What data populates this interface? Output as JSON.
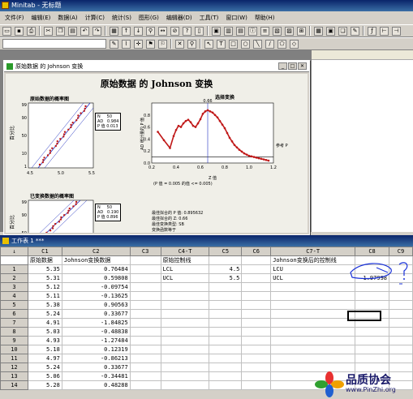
{
  "app": {
    "title": "Minitab - 无标题"
  },
  "menu": [
    "文件(F)",
    "编辑(E)",
    "数据(A)",
    "计算(C)",
    "统计(S)",
    "图形(G)",
    "编辑器(D)",
    "工具(T)",
    "窗口(W)",
    "帮助(H)"
  ],
  "graph_window": {
    "title": "原始数据 的 Johnson 变换",
    "graph_title": "原始数据 的 Johnson 变换",
    "pp_orig_title": "原始数据的概率图",
    "pp_orig_ylabel": "百分比",
    "pp_orig_legend": "N     50\nAD   0.984\nP 值 0.013",
    "pp_trans_title": "已变换数据的概率图",
    "pp_trans_ylabel": "百分比",
    "pp_trans_legend": "N     50\nAD   0.190\nP 值 0.896",
    "sel_title": "选择变换",
    "sel_ylabel": "AD 统计量的 P 值",
    "sel_xlabel": "Z 值",
    "sel_ref_label": "参考 P",
    "sel_peak_label": "0.66",
    "sel_note": "(P 值 = 0.005 的值 <= 0.005)",
    "info_lines": [
      "最佳拟合的 P 值: 0.895632",
      "最佳拟合的 Z: 0.66",
      "最佳变换类型: SB",
      "变换函数等于"
    ]
  },
  "chart_data": [
    {
      "type": "scatter",
      "title": "原始数据的概率图",
      "ylabel": "百分比",
      "xlim": [
        4.5,
        5.5
      ],
      "x_ticks": [
        "4.5",
        "5.0",
        "5.5"
      ],
      "y_ticks": [
        "99",
        "90",
        "50",
        "10",
        "1"
      ],
      "legend": {
        "N": 50,
        "AD": 0.984,
        "P 值": 0.013
      }
    },
    {
      "type": "line",
      "title": "选择变换",
      "xlabel": "Z 值",
      "ylabel": "AD 统计量的 P 值",
      "xlim": [
        0.2,
        1.2
      ],
      "ylim": [
        0,
        1.0
      ],
      "x_ticks": [
        "0.2",
        "0.4",
        "0.6",
        "0.8",
        "1.0",
        "1.2"
      ],
      "y_ticks": [
        "0.0",
        "0.2",
        "0.4",
        "0.6",
        "0.8"
      ],
      "reference_p": 0.1,
      "best_z": 0.66,
      "x": [
        0.25,
        0.3,
        0.35,
        0.38,
        0.4,
        0.42,
        0.44,
        0.46,
        0.48,
        0.5,
        0.52,
        0.54,
        0.56,
        0.58,
        0.6,
        0.62,
        0.64,
        0.66,
        0.68,
        0.7,
        0.72,
        0.74,
        0.76,
        0.78,
        0.8,
        0.82,
        0.84,
        0.86,
        0.88,
        0.9,
        0.92,
        0.94,
        0.96,
        0.98,
        1.0,
        1.02,
        1.04,
        1.06,
        1.08,
        1.1,
        1.12,
        1.14,
        1.16
      ],
      "y": [
        0.52,
        0.38,
        0.25,
        0.45,
        0.55,
        0.62,
        0.6,
        0.66,
        0.7,
        0.72,
        0.68,
        0.62,
        0.6,
        0.66,
        0.73,
        0.82,
        0.86,
        0.88,
        0.86,
        0.84,
        0.8,
        0.76,
        0.7,
        0.64,
        0.58,
        0.5,
        0.42,
        0.36,
        0.3,
        0.26,
        0.22,
        0.19,
        0.16,
        0.14,
        0.12,
        0.11,
        0.1,
        0.09,
        0.08,
        0.07,
        0.06,
        0.05,
        0.04
      ]
    },
    {
      "type": "scatter",
      "title": "已变换数据的概率图",
      "ylabel": "百分比",
      "y_ticks": [
        "99",
        "90",
        "50"
      ],
      "legend": {
        "N": 50,
        "AD": 0.19,
        "P 值": 0.896
      }
    }
  ],
  "worksheet": {
    "title": "工作表 1 ***",
    "col_headers": [
      "↓",
      "C1",
      "C2",
      "C3",
      "C4-T",
      "C5",
      "C6",
      "C7-T",
      "C8",
      "C9"
    ],
    "col_names": [
      "",
      "原始数据",
      "Johnson变换数据",
      "",
      "原始控制线",
      "",
      "",
      "Johnson变换后的控制线",
      "",
      ""
    ],
    "rows": [
      [
        "1",
        "5.35",
        "0.76484",
        "",
        "LCL",
        "4.5",
        "",
        "LCU",
        "",
        ""
      ],
      [
        "2",
        "5.31",
        "0.59808",
        "",
        "UCL",
        "5.5",
        "",
        "UCL",
        "1.97998",
        ""
      ],
      [
        "3",
        "5.12",
        "-0.09754",
        "",
        "",
        "",
        "",
        "",
        "",
        ""
      ],
      [
        "4",
        "5.11",
        "-0.13625",
        "",
        "",
        "",
        "",
        "",
        "",
        ""
      ],
      [
        "5",
        "5.38",
        "0.90563",
        "",
        "",
        "",
        "",
        "",
        "",
        ""
      ],
      [
        "6",
        "5.24",
        "0.33677",
        "",
        "",
        "",
        "",
        "",
        "",
        ""
      ],
      [
        "7",
        "4.91",
        "-1.84825",
        "",
        "",
        "",
        "",
        "",
        "",
        ""
      ],
      [
        "8",
        "5.03",
        "-0.48838",
        "",
        "",
        "",
        "",
        "",
        "",
        ""
      ],
      [
        "9",
        "4.93",
        "-1.27484",
        "",
        "",
        "",
        "",
        "",
        "",
        ""
      ],
      [
        "10",
        "5.18",
        "0.12319",
        "",
        "",
        "",
        "",
        "",
        "",
        ""
      ],
      [
        "11",
        "4.97",
        "-0.86213",
        "",
        "",
        "",
        "",
        "",
        "",
        ""
      ],
      [
        "12",
        "5.24",
        "0.33677",
        "",
        "",
        "",
        "",
        "",
        "",
        ""
      ],
      [
        "13",
        "5.06",
        "-0.34481",
        "",
        "",
        "",
        "",
        "",
        "",
        ""
      ],
      [
        "14",
        "5.28",
        "0.48288",
        "",
        "",
        "",
        "",
        "",
        "",
        ""
      ]
    ]
  },
  "watermark": {
    "zh": "品质协会",
    "en": "www.PinZhi.org"
  }
}
